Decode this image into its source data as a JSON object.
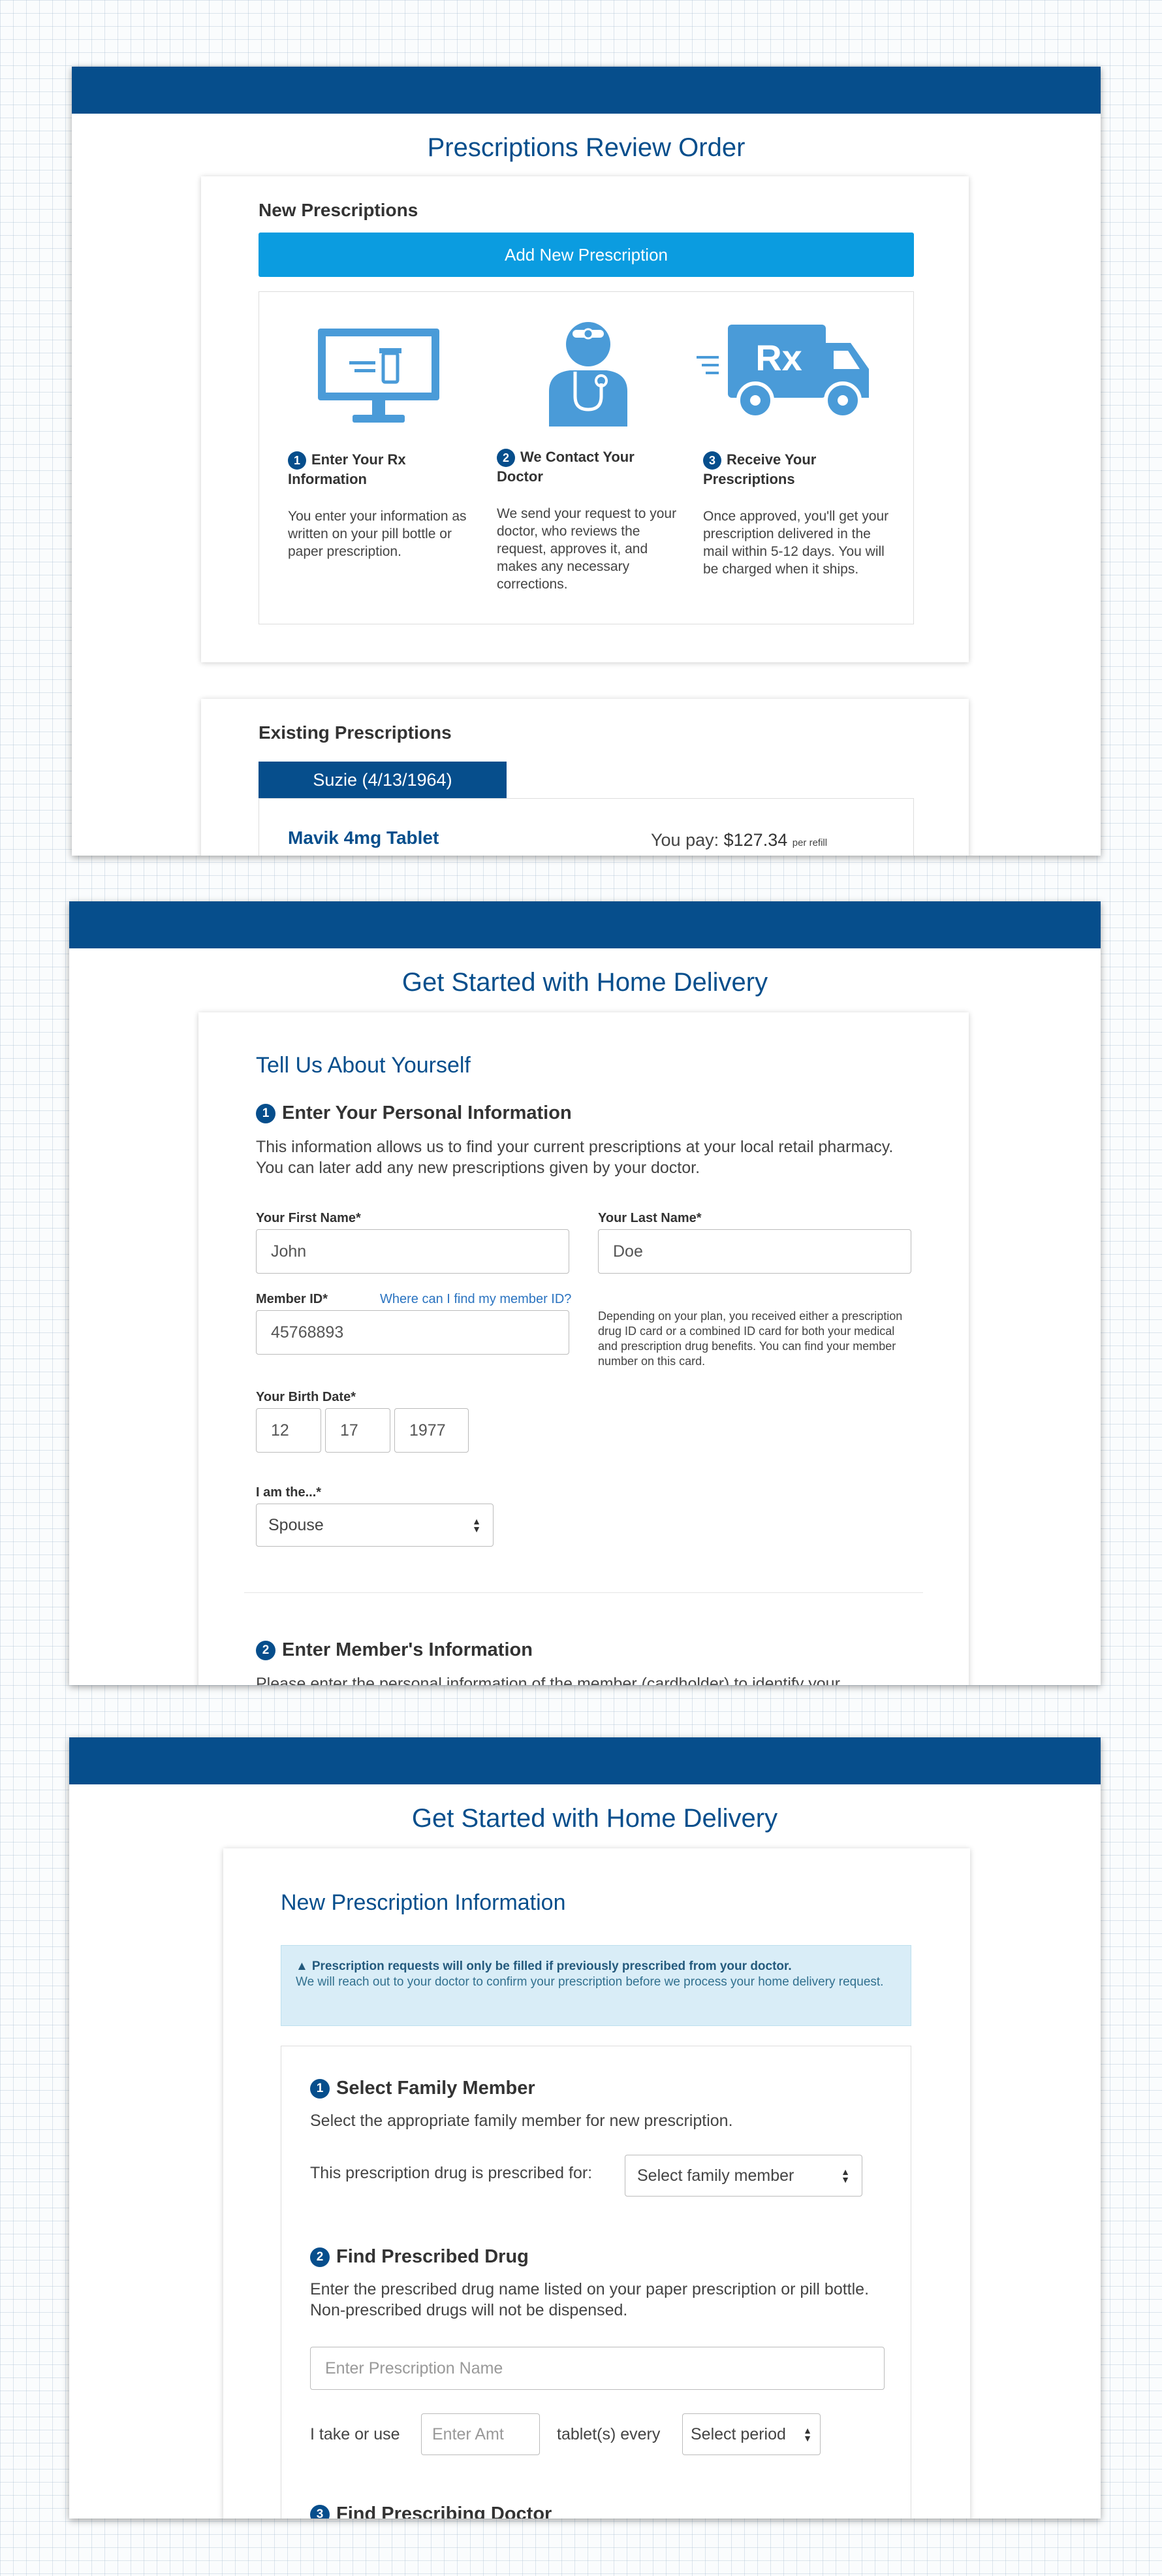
{
  "screen1": {
    "title": "Prescriptions Review Order",
    "new_prescriptions": {
      "heading": "New Prescriptions",
      "add_button": "Add New Prescription",
      "steps": [
        {
          "num": "1",
          "title": "Enter Your Rx Information",
          "body": "You enter your information as written on your pill bottle or paper prescription.",
          "icon": "computer-monitor-icon"
        },
        {
          "num": "2",
          "title": "We Contact Your Doctor",
          "body": "We send your request to your doctor, who reviews the request, approves it, and makes any necessary corrections.",
          "icon": "doctor-icon"
        },
        {
          "num": "3",
          "title": "Receive Your Prescriptions",
          "body": "Once approved, you'll get your prescription delivered in the mail within 5-12 days. You will be charged when it ships.",
          "icon": "delivery-truck-icon",
          "truck_label": "Rx"
        }
      ]
    },
    "existing": {
      "heading": "Existing Prescriptions",
      "tab": "Suzie (4/13/1964)",
      "drug": "Mavik 4mg Tablet",
      "you_pay_label": "You pay:",
      "price": "$127.34",
      "per": "per refill"
    }
  },
  "screen2": {
    "title": "Get Started with Home Delivery",
    "card_title": "Tell Us About Yourself",
    "step1": {
      "num": "1",
      "heading": "Enter Your Personal Information",
      "desc": "This information allows us to find your current prescriptions at your local retail pharmacy. You can later add any new prescriptions given by your doctor."
    },
    "first_name": {
      "label": "Your First Name*",
      "value": "John"
    },
    "last_name": {
      "label": "Your Last Name*",
      "value": "Doe"
    },
    "member_id": {
      "label": "Member ID*",
      "link": "Where can I find my member ID?",
      "value": "45768893",
      "help": "Depending on your plan, you received either a prescription drug ID card or a combined ID card for both your medical and prescription drug benefits. You can find your member number on this card."
    },
    "birth_date": {
      "label": "Your Birth Date*",
      "month": "12",
      "day": "17",
      "year": "1977"
    },
    "relation": {
      "label": "I am the...*",
      "value": "Spouse"
    },
    "step2": {
      "num": "2",
      "heading": "Enter Member's Information",
      "desc": "Please enter the personal information of the member (cardholder) to identify your"
    }
  },
  "screen3": {
    "title": "Get Started with Home Delivery",
    "card_title": "New Prescription Information",
    "alert": {
      "strong": "Prescription requests will only be filled if previously prescribed from your doctor.",
      "text": "We will reach out to your doctor to confirm your prescription before we process your home delivery request."
    },
    "step1": {
      "num": "1",
      "heading": "Select Family Member",
      "desc": "Select the appropriate family member for new prescription.",
      "prescribed_for": "This prescription drug is prescribed for:",
      "select": "Select family member"
    },
    "step2": {
      "num": "2",
      "heading": "Find Prescribed Drug",
      "desc": "Enter the prescribed drug name listed on your paper prescription or pill bottle. Non-prescribed drugs will not be dispensed.",
      "drug_placeholder": "Enter Prescription Name",
      "take_label": "I take or use",
      "amount_placeholder": "Enter Amt",
      "every_label": "tablet(s) every",
      "period_select": "Select period"
    },
    "step3": {
      "num": "3",
      "heading": "Find Prescribing Doctor"
    }
  },
  "colors": {
    "brand": "#064e8c",
    "accent": "#0b9ce0",
    "icon": "#4a9bd8",
    "alert_bg": "#d9edf7"
  }
}
